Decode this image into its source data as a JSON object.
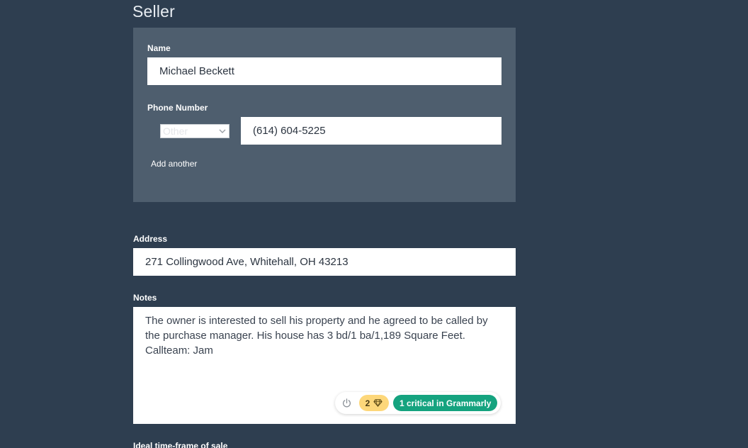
{
  "section": {
    "title": "Seller"
  },
  "seller": {
    "name_label": "Name",
    "name_value": "Michael Beckett",
    "phone_label": "Phone Number",
    "phone_type": "Other",
    "phone_value": "(614) 604-5225",
    "add_another": "Add another"
  },
  "address": {
    "label": "Address",
    "value": "271 Collingwood Ave, Whitehall, OH 43213"
  },
  "notes": {
    "label": "Notes",
    "value": "The owner is interested to sell his property and he agreed to be called by the purchase manager. His house has 3 bd/1 ba/1,189 Square Feet. Callteam: Jam"
  },
  "grammarly": {
    "premium_count": "2",
    "critical_label": "1 critical in Grammarly",
    "icons": [
      "power-icon",
      "diamond-icon"
    ],
    "colors": {
      "premium": "#fdd77a",
      "critical": "#15a37f"
    }
  },
  "next_section": {
    "label": "Ideal time-frame of sale"
  }
}
